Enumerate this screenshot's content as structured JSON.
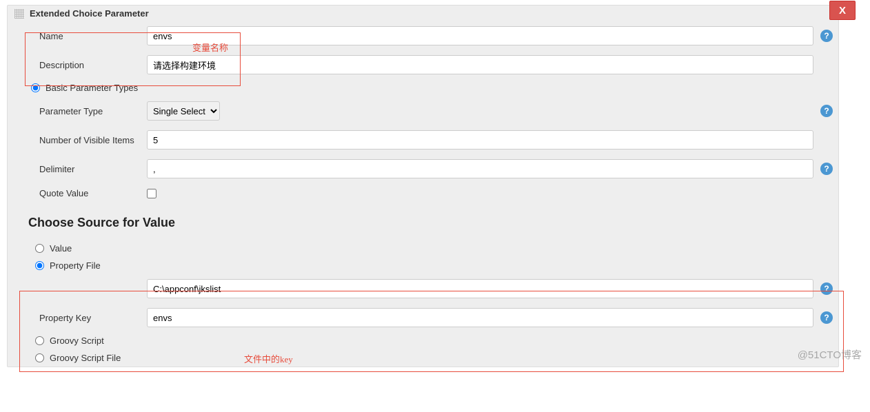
{
  "panel": {
    "title": "Extended Choice Parameter",
    "close_label": "X"
  },
  "annotations": {
    "var_name": "变量名称",
    "file_key": "文件中的key"
  },
  "fields": {
    "name": {
      "label": "Name",
      "value": "envs"
    },
    "description": {
      "label": "Description",
      "value": "请选择构建环境"
    },
    "basic_types": {
      "label": "Basic Parameter Types"
    },
    "parameter_type": {
      "label": "Parameter Type",
      "selected": "Single Select"
    },
    "visible_items": {
      "label": "Number of Visible Items",
      "value": "5"
    },
    "delimiter": {
      "label": "Delimiter",
      "value": ","
    },
    "quote_value": {
      "label": "Quote Value"
    }
  },
  "choose_source": {
    "heading": "Choose Source for Value",
    "options": {
      "value": "Value",
      "property_file": "Property File",
      "groovy_script": "Groovy Script",
      "groovy_script_file": "Groovy Script File"
    },
    "property_file_path": {
      "value": "C:\\appconf\\jkslist"
    },
    "property_key": {
      "label": "Property Key",
      "value": "envs"
    }
  },
  "help_glyph": "?",
  "watermark": "@51CTO博客"
}
